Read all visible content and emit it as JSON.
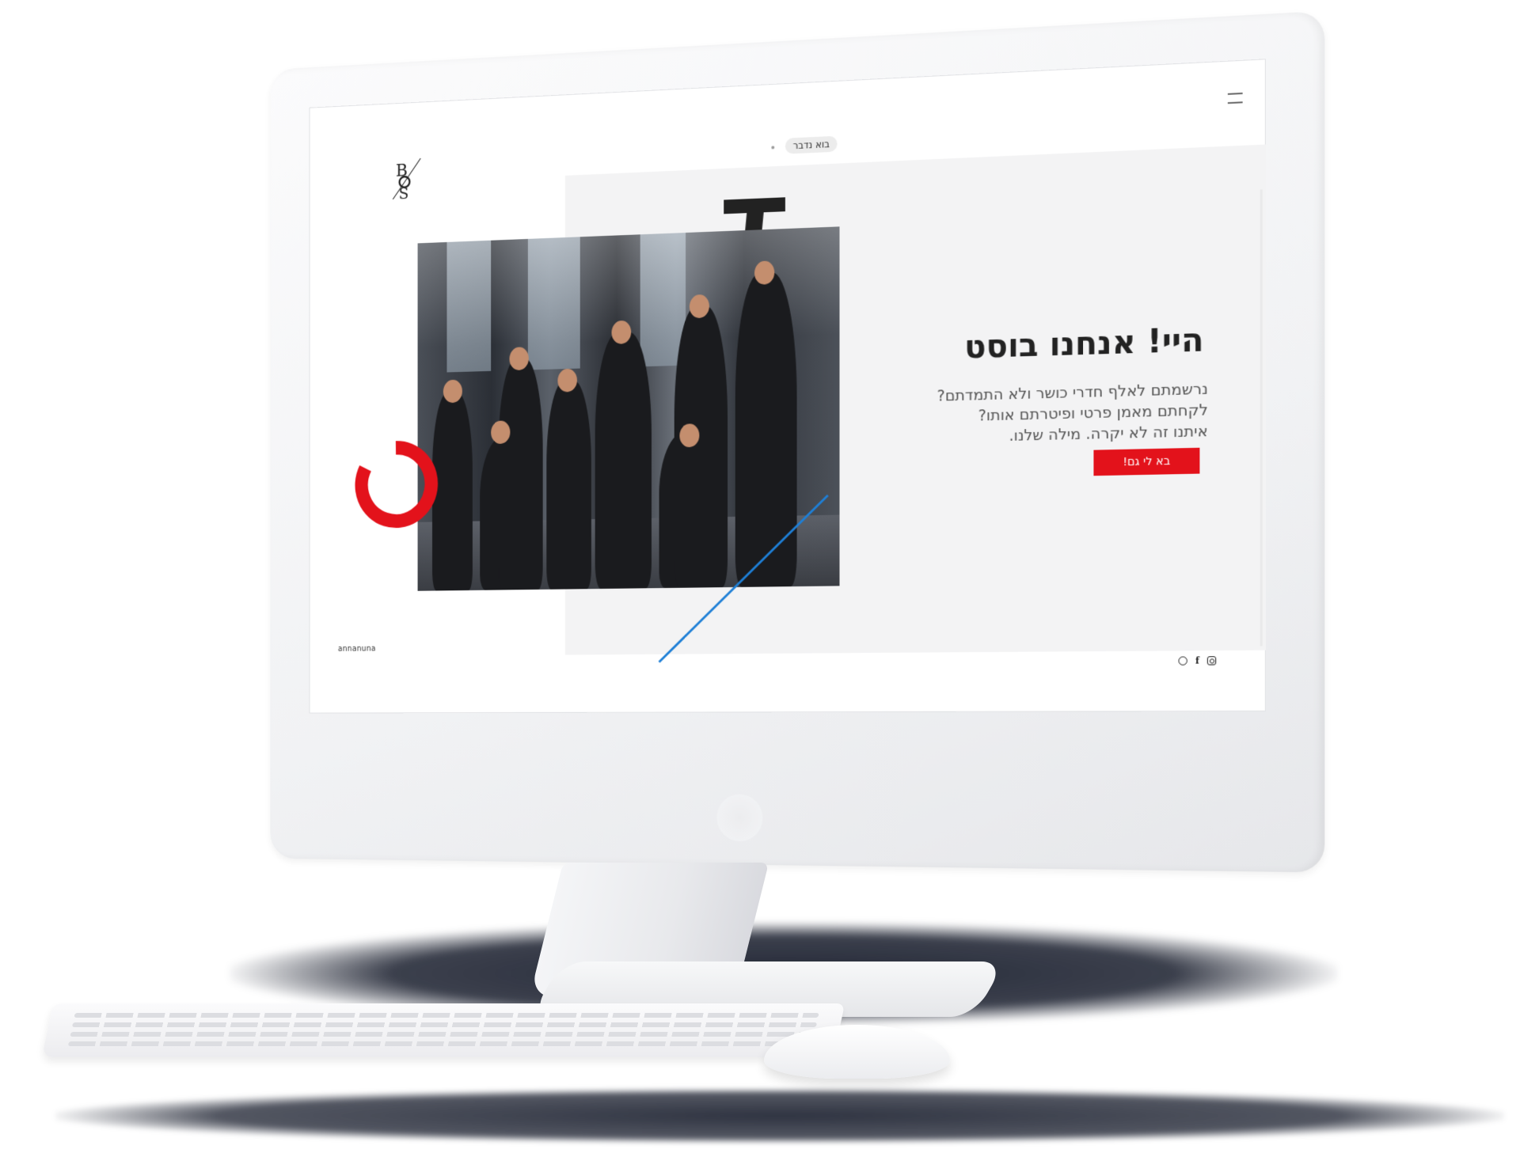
{
  "site": {
    "talk_label": "בוא נדבר",
    "hero_title": "היי! אנחנו בוסט",
    "hero_lines": [
      "נרשמתם לאלף חדרי כושר ולא התמדתם?",
      "לקחתם מאמן פרטי ופיטרתם אותו?",
      "איתנו זה לא יקרה. מילה שלנו."
    ],
    "cta_label": "בא לי גם!",
    "footer_brand": "annanuna"
  },
  "icons": {
    "menu": "hamburger-icon",
    "logo": "boost-logo",
    "social": [
      "instagram-icon",
      "facebook-icon",
      "whatsapp-icon"
    ]
  },
  "colors": {
    "accent_red": "#e3121b",
    "accent_blue": "#1e7fd6",
    "panel_grey": "#f3f3f4",
    "text_dark": "#222222"
  }
}
